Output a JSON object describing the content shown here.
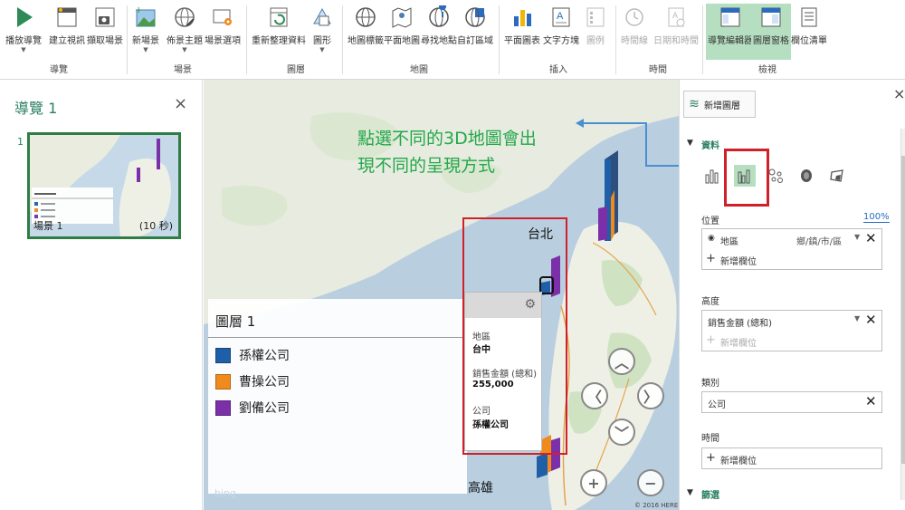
{
  "ribbon": {
    "buttons": [
      {
        "label": "播放導覽",
        "icon": "play-icon"
      },
      {
        "label": "建立視訊",
        "icon": "video-icon"
      },
      {
        "label": "擷取場景",
        "icon": "camera-icon"
      },
      {
        "label": "新場景",
        "icon": "new-scene-icon"
      },
      {
        "label": "佈景主題",
        "icon": "theme-globe-icon"
      },
      {
        "label": "場景選項",
        "icon": "scene-options-icon"
      },
      {
        "label": "重新整理資料",
        "icon": "refresh-icon"
      },
      {
        "label": "圖形",
        "icon": "shapes-icon"
      },
      {
        "label": "地圖標籤",
        "icon": "map-labels-icon"
      },
      {
        "label": "平面地圖",
        "icon": "flat-map-icon"
      },
      {
        "label": "尋找地點",
        "icon": "find-location-icon"
      },
      {
        "label": "自訂區域",
        "icon": "custom-region-icon"
      },
      {
        "label": "平面圖表",
        "icon": "2d-chart-icon"
      },
      {
        "label": "文字方塊",
        "icon": "text-box-icon"
      },
      {
        "label": "圖例",
        "icon": "legend-icon"
      },
      {
        "label": "時間線",
        "icon": "timeline-icon"
      },
      {
        "label": "日期和時間",
        "icon": "date-time-icon"
      },
      {
        "label": "導覽編輯器",
        "icon": "tour-editor-icon"
      },
      {
        "label": "圖層窗格",
        "icon": "layer-pane-icon"
      },
      {
        "label": "欄位清單",
        "icon": "field-list-icon"
      }
    ],
    "groups": [
      "導覽",
      "場景",
      "圖層",
      "地圖",
      "插入",
      "時間",
      "檢視"
    ]
  },
  "tour_pane": {
    "title": "導覽 1",
    "scene_number": "1",
    "scene_label": "場景 1",
    "scene_duration": "(10 秒)"
  },
  "map": {
    "annotation_line1": "點選不同的3D地圖會出",
    "annotation_line2": "現不同的呈現方式",
    "city_north": "台北",
    "city_south": "高雄",
    "copyright": "© 2016 HERE",
    "bing": "bing",
    "legend": {
      "title": "圖層 1",
      "items": [
        {
          "label": "孫權公司",
          "color": "#1f5fa8"
        },
        {
          "label": "曹操公司",
          "color": "#f08a1c"
        },
        {
          "label": "劉備公司",
          "color": "#7b2fa8"
        }
      ]
    },
    "tooltip": {
      "field1": "地區",
      "value1": "台中",
      "field2": "銷售金額 (總和)",
      "value2": "255,000",
      "field3": "公司",
      "value3": "孫權公司"
    }
  },
  "layer_pane": {
    "new_layer": "新增圖層",
    "section_data": "資料",
    "location_label": "位置",
    "location_pct": "100%",
    "location_field": "地區",
    "location_type": "鄉/鎮/市/區",
    "add_field": "新增欄位",
    "height_label": "高度",
    "height_field": "銷售金額 (總和)",
    "category_label": "類別",
    "category_field": "公司",
    "time_label": "時間",
    "section_filter": "篩選"
  }
}
